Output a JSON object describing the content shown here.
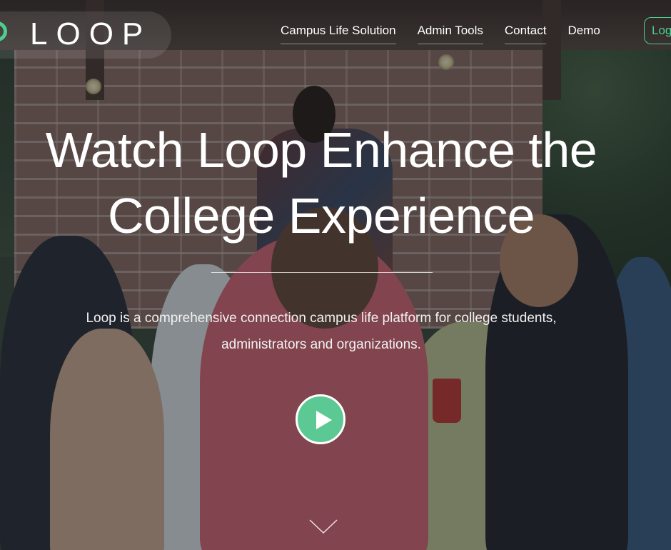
{
  "header": {
    "logo_text": "LOOP",
    "logo_icon": "loop-ring-icon",
    "nav": [
      {
        "label": "Campus Life Solution",
        "underlined": true
      },
      {
        "label": "Admin Tools",
        "underlined": true
      },
      {
        "label": "Contact",
        "underlined": true
      },
      {
        "label": "Demo",
        "underlined": false
      }
    ],
    "login_label": "Log"
  },
  "hero": {
    "title": "Watch Loop Enhance the College Experience",
    "subtitle": "Loop is a comprehensive connection campus life platform for college students, administrators and organizations.",
    "play_icon": "play-icon",
    "scroll_icon": "chevron-down-icon"
  },
  "colors": {
    "accent": "#4ccf8e",
    "play_button": "#5cc994",
    "text": "#ffffff"
  }
}
